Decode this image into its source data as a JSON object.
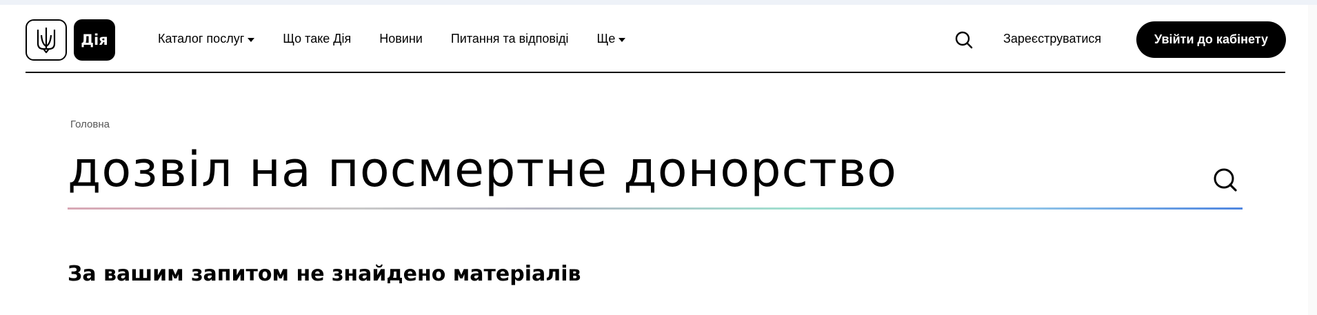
{
  "header": {
    "logo_text": "Дія",
    "nav": [
      {
        "label": "Каталог послуг",
        "dropdown": true
      },
      {
        "label": "Що таке Дія",
        "dropdown": false
      },
      {
        "label": "Новини",
        "dropdown": false
      },
      {
        "label": "Питання та відповіді",
        "dropdown": false
      },
      {
        "label": "Ще",
        "dropdown": true
      }
    ],
    "register_label": "Зареєструватися",
    "login_label": "Увійти до кабінету"
  },
  "breadcrumb": {
    "home_label": "Головна"
  },
  "search": {
    "value": "дозвіл на посмертне донорство"
  },
  "results": {
    "empty_message": "За вашим запитом не знайдено матеріалів"
  },
  "colors": {
    "primary": "#000000",
    "background": "#ffffff",
    "gradient_end": "#4f86e0"
  },
  "icons": {
    "coat_of_arms": "trident-icon",
    "search": "search-icon",
    "dropdown": "caret-down-icon"
  }
}
